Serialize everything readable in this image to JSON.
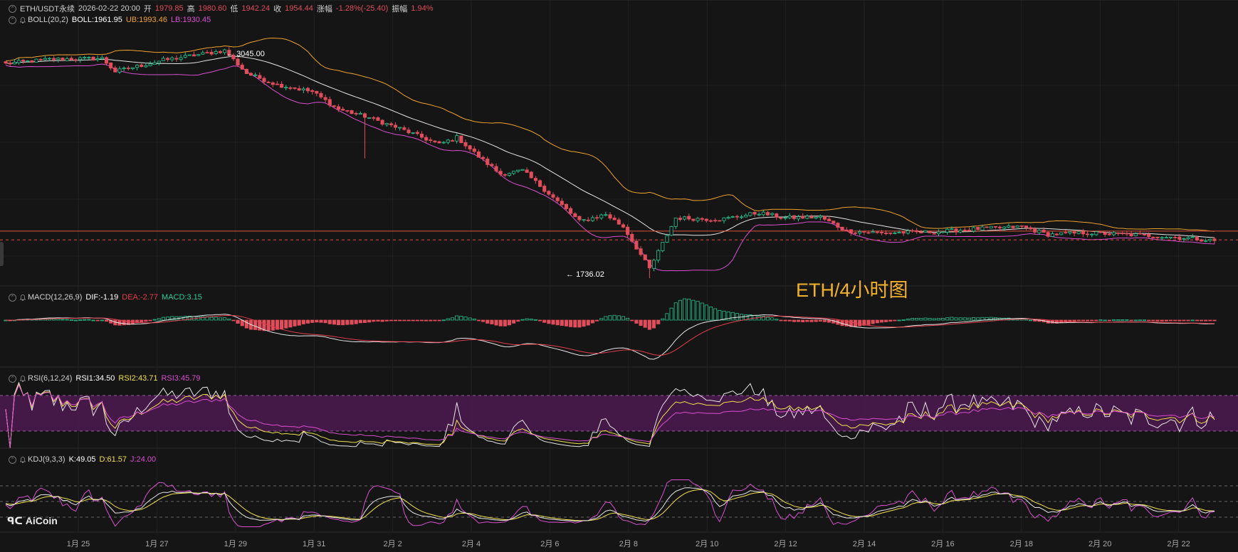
{
  "chart_data": {
    "type": "candlestick",
    "symbol": "ETH/USDT永续",
    "timeframe": "4H",
    "ohlc_header": {
      "datetime": "2026-02-22 20:00",
      "open_label": "开",
      "open": "1979.85",
      "high_label": "高",
      "high": "1980.60",
      "low_label": "低",
      "low": "1942.24",
      "close_label": "收",
      "close": "1954.44",
      "change_label": "涨幅",
      "change": "-1.28%(-25.40)",
      "amplitude_label": "振幅",
      "amplitude": "1.94%"
    },
    "boll": {
      "name": "BOLL(20,2)",
      "mid_label": "BOLL:",
      "mid": "1961.95",
      "ub_label": "UB:",
      "ub": "1993.46",
      "lb_label": "LB:",
      "lb": "1930.45"
    },
    "macd": {
      "name": "MACD(12,26,9)",
      "dif_label": "DIF:",
      "dif": "-1.19",
      "dea_label": "DEA:",
      "dea": "-2.77",
      "macd_label": "MACD:",
      "macd": "3.15"
    },
    "rsi": {
      "name": "RSI(6,12,24)",
      "rsi1_label": "RSI1:",
      "rsi1": "34.50",
      "rsi2_label": "RSI2:",
      "rsi2": "43.71",
      "rsi3_label": "RSI3:",
      "rsi3": "45.79"
    },
    "kdj": {
      "name": "KDJ(9,3,3)",
      "k_label": "K:",
      "k": "49.05",
      "d_label": "D:",
      "d": "61.57",
      "j_label": "J:",
      "j": "24.00"
    },
    "extremes": {
      "high": "3045.00",
      "low": "1736.02"
    },
    "x_ticks": [
      "1月 25",
      "1月 27",
      "1月 29",
      "1月 31",
      "2月 2",
      "2月 4",
      "2月 6",
      "2月 8",
      "2月 10",
      "2月 12",
      "2月 14",
      "2月 16",
      "2月 18",
      "2月 20",
      "2月 22"
    ],
    "close_path_anchors": [
      [
        0,
        2960
      ],
      [
        10,
        2985
      ],
      [
        22,
        2990
      ],
      [
        25,
        2915
      ],
      [
        36,
        2980
      ],
      [
        50,
        3035
      ],
      [
        55,
        2905
      ],
      [
        62,
        2840
      ],
      [
        70,
        2800
      ],
      [
        76,
        2700
      ],
      [
        82,
        2660
      ],
      [
        90,
        2590
      ],
      [
        99,
        2500
      ],
      [
        103,
        2540
      ],
      [
        108,
        2430
      ],
      [
        113,
        2330
      ],
      [
        118,
        2350
      ],
      [
        124,
        2220
      ],
      [
        131,
        2060
      ],
      [
        137,
        2100
      ],
      [
        141,
        2030
      ],
      [
        147,
        1790
      ],
      [
        153,
        2080
      ],
      [
        163,
        2070
      ],
      [
        172,
        2110
      ],
      [
        178,
        2080
      ],
      [
        186,
        2085
      ],
      [
        192,
        2005
      ],
      [
        200,
        1995
      ],
      [
        212,
        2000
      ],
      [
        220,
        2015
      ],
      [
        232,
        2030
      ],
      [
        238,
        1985
      ],
      [
        246,
        1995
      ],
      [
        252,
        1990
      ],
      [
        260,
        1980
      ],
      [
        270,
        1965
      ],
      [
        276,
        1950
      ]
    ],
    "colors": {
      "up": "#27c28e",
      "down": "#e04d5b",
      "mid": "#e6e6e6",
      "ub": "#f0a22c",
      "lb": "#d94fd0"
    }
  },
  "annotation": "ETH/4小时图",
  "logo": "AiCoin",
  "icons": [
    "collapse-chevron-icon",
    "bell-icon",
    "aicoin-logo-icon"
  ]
}
